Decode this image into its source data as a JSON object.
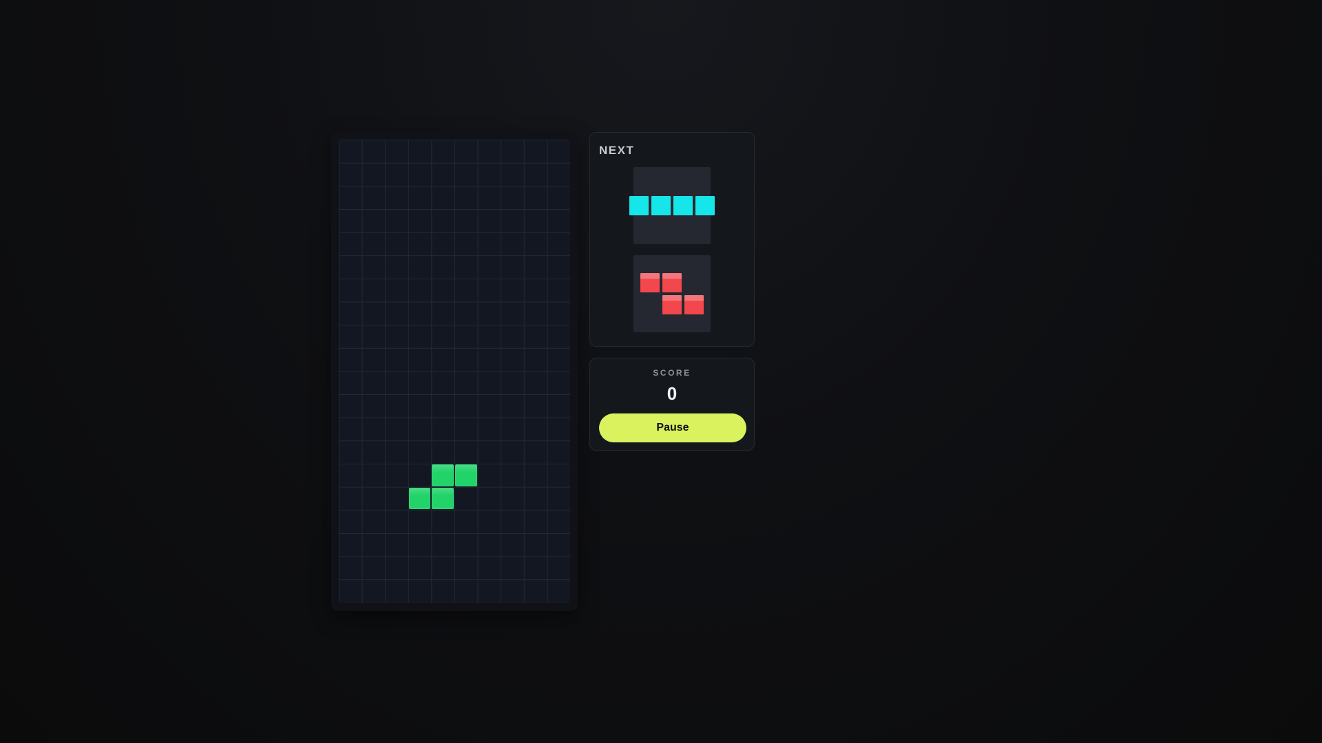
{
  "board": {
    "columns": 10,
    "rows": 20,
    "active_piece": {
      "type": "S",
      "color": "#22d36a",
      "cells": [
        [
          4,
          14
        ],
        [
          5,
          14
        ],
        [
          3,
          15
        ],
        [
          4,
          15
        ]
      ]
    }
  },
  "next": {
    "title": "NEXT",
    "pieces": [
      {
        "type": "I",
        "color": "#16e6ea",
        "cells": [
          [
            0,
            0
          ],
          [
            1,
            0
          ],
          [
            2,
            0
          ],
          [
            3,
            0
          ]
        ]
      },
      {
        "type": "Z",
        "color": "#f2484d",
        "cells": [
          [
            0,
            0
          ],
          [
            1,
            0
          ],
          [
            1,
            1
          ],
          [
            2,
            1
          ]
        ]
      }
    ]
  },
  "score": {
    "label": "SCORE",
    "value": "0"
  },
  "controls": {
    "pause_label": "Pause"
  }
}
